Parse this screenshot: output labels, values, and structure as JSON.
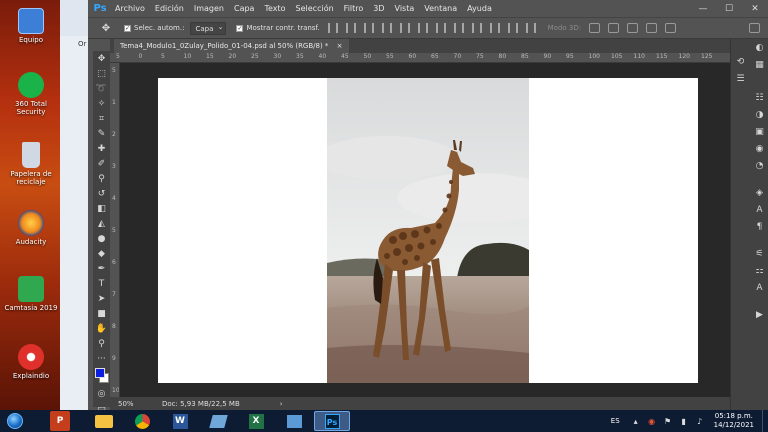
{
  "desktop": {
    "icons": [
      {
        "label": "Equipo",
        "color": "#3d7fd6"
      },
      {
        "label": "360 Total Security",
        "color": "#19b34a"
      },
      {
        "label": "Papelera de reciclaje",
        "color": "#d0d8e4"
      },
      {
        "label": "Audacity",
        "color": "#f08a1c"
      },
      {
        "label": "Camtasia 2019",
        "color": "#2fa84f"
      },
      {
        "label": "Explaindio",
        "color": "#e0302b"
      }
    ],
    "behind_window_text": [
      "Or",
      "Ar",
      "Ai",
      "ad",
      "Ac"
    ]
  },
  "photoshop": {
    "app_icon": "Ps",
    "menu": [
      "Archivo",
      "Edición",
      "Imagen",
      "Capa",
      "Texto",
      "Selección",
      "Filtro",
      "3D",
      "Vista",
      "Ventana",
      "Ayuda"
    ],
    "window_controls": {
      "minimize": "—",
      "maximize": "☐",
      "close": "✕"
    },
    "options": {
      "auto_select_label": "Selec. autom.:",
      "auto_select_value": "Capa",
      "show_transform_label": "Mostrar contr. transf.",
      "mode3d_label": "Modo 3D:"
    },
    "document_tab": {
      "title": "Tema4_Modulo1_0Zulay_Polido_01-04.psd al 50% (RGB/8) *",
      "close": "×"
    },
    "ruler_top_ticks": [
      "5",
      "0",
      "5",
      "10",
      "15",
      "20",
      "25",
      "30",
      "35",
      "40",
      "45",
      "50",
      "55",
      "60",
      "65",
      "70",
      "75",
      "80",
      "85",
      "90",
      "95",
      "100",
      "105",
      "110",
      "115",
      "120",
      "125"
    ],
    "ruler_left_ticks": [
      "5",
      "1",
      "2",
      "3",
      "4",
      "5",
      "6",
      "7",
      "8",
      "9",
      "10"
    ],
    "status": {
      "zoom": "50%",
      "doc_size": "Doc: 5,93 MB/22,5 MB",
      "arrow": "›"
    },
    "tools": [
      "move-icon",
      "marquee-icon",
      "lasso-icon",
      "magic-wand-icon",
      "crop-icon",
      "eyedropper-icon",
      "healing-brush-icon",
      "brush-icon",
      "clone-stamp-icon",
      "history-brush-icon",
      "eraser-icon",
      "paint-bucket-icon",
      "dodge-icon",
      "blur-icon",
      "pen-icon",
      "type-icon",
      "path-selection-icon",
      "rectangle-icon",
      "hand-icon",
      "zoom-icon",
      "more-tools-icon"
    ],
    "colors": {
      "foreground": "#0d1de0",
      "background": "#ffffff"
    }
  },
  "taskbar": {
    "apps": [
      "explorer",
      "chrome",
      "word",
      "excel",
      "xpress",
      "excel2",
      "photoshop"
    ],
    "language": "ES",
    "clock_time": "05:18 p.m.",
    "clock_date": "14/12/2021"
  }
}
